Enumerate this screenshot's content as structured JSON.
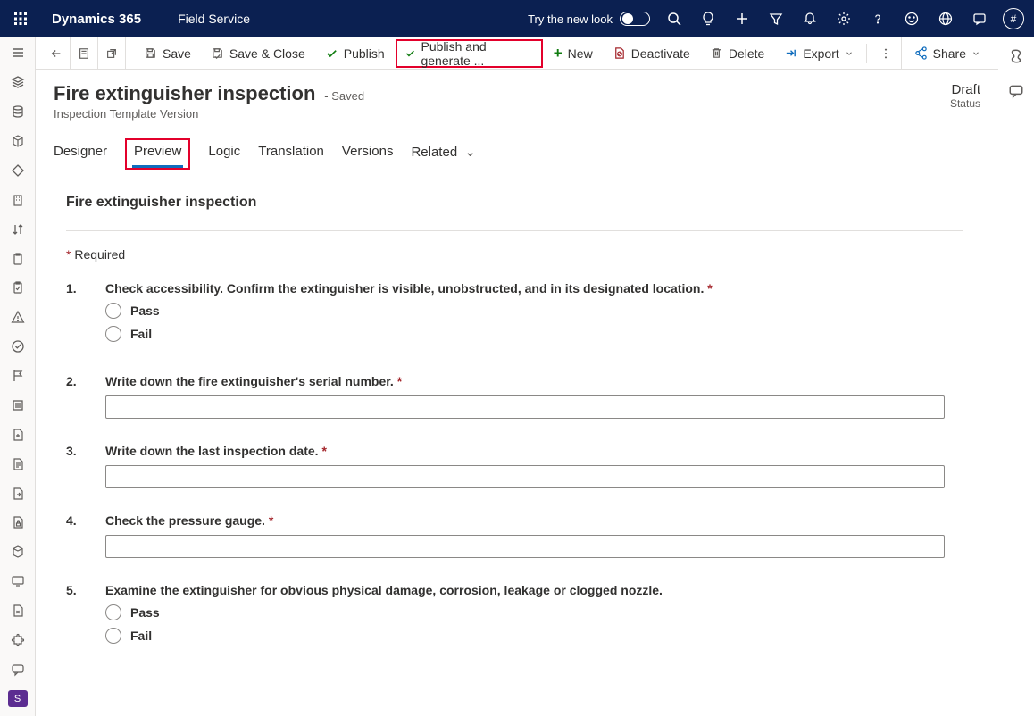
{
  "topnav": {
    "brand": "Dynamics 365",
    "app": "Field Service",
    "try_look": "Try the new look"
  },
  "commandbar": {
    "save": "Save",
    "save_close": "Save & Close",
    "publish": "Publish",
    "publish_generate": "Publish and generate ...",
    "new": "New",
    "deactivate": "Deactivate",
    "delete": "Delete",
    "export": "Export",
    "share": "Share"
  },
  "record": {
    "title": "Fire extinguisher inspection",
    "saved": "- Saved",
    "subtitle": "Inspection Template Version",
    "status_main": "Draft",
    "status_sub": "Status"
  },
  "tabs": {
    "designer": "Designer",
    "preview": "Preview",
    "logic": "Logic",
    "translation": "Translation",
    "versions": "Versions",
    "related": "Related"
  },
  "form": {
    "title": "Fire extinguisher inspection",
    "required_label": "Required",
    "questions": [
      {
        "num": "1.",
        "text": "Check accessibility. Confirm the extinguisher is visible, unobstructed, and in its designated location.",
        "required": true,
        "type": "radio",
        "options": [
          "Pass",
          "Fail"
        ]
      },
      {
        "num": "2.",
        "text": "Write down the fire extinguisher's serial number.",
        "required": true,
        "type": "text"
      },
      {
        "num": "3.",
        "text": "Write down the last inspection date.",
        "required": true,
        "type": "text"
      },
      {
        "num": "4.",
        "text": "Check the pressure gauge.",
        "required": true,
        "type": "text"
      },
      {
        "num": "5.",
        "text": "Examine the extinguisher for obvious physical damage, corrosion, leakage or clogged nozzle.",
        "required": false,
        "type": "radio",
        "options": [
          "Pass",
          "Fail"
        ]
      }
    ]
  }
}
